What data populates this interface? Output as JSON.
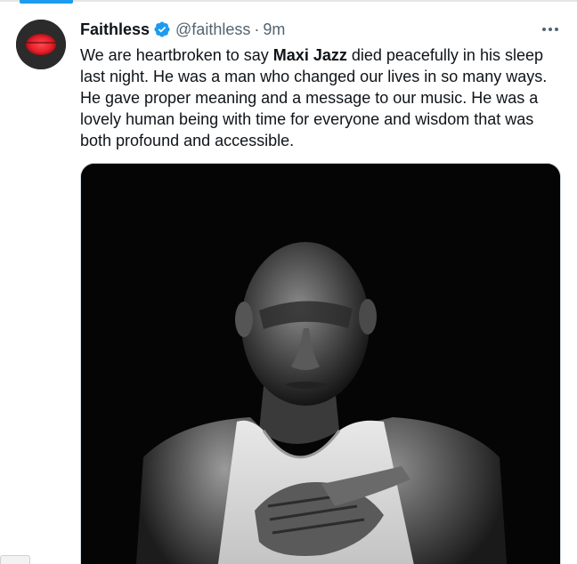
{
  "tweet": {
    "author": {
      "display_name": "Faithless",
      "handle": "@faithless",
      "verified": true,
      "avatar_icon": "faithless-logo-avatar"
    },
    "separator": "·",
    "time": "9m",
    "more_icon": "more-horizontal-icon",
    "text": {
      "before": "We are heartbroken to say ",
      "bold": "Maxi Jazz",
      "after": " died peacefully in his sleep last night. He was a man who changed our lives in so many ways. He gave proper meaning and a message to our music. He was a lovely human being with time for everyone and wisdom that was both profound and accessible."
    },
    "media": {
      "kind": "photo",
      "description_icon": "black-and-white-portrait-photo"
    }
  },
  "colors": {
    "accent": "#1d9bf0",
    "secondary_text": "#536471",
    "primary_text": "#0f1419",
    "avatar_red": "#e8202a"
  }
}
